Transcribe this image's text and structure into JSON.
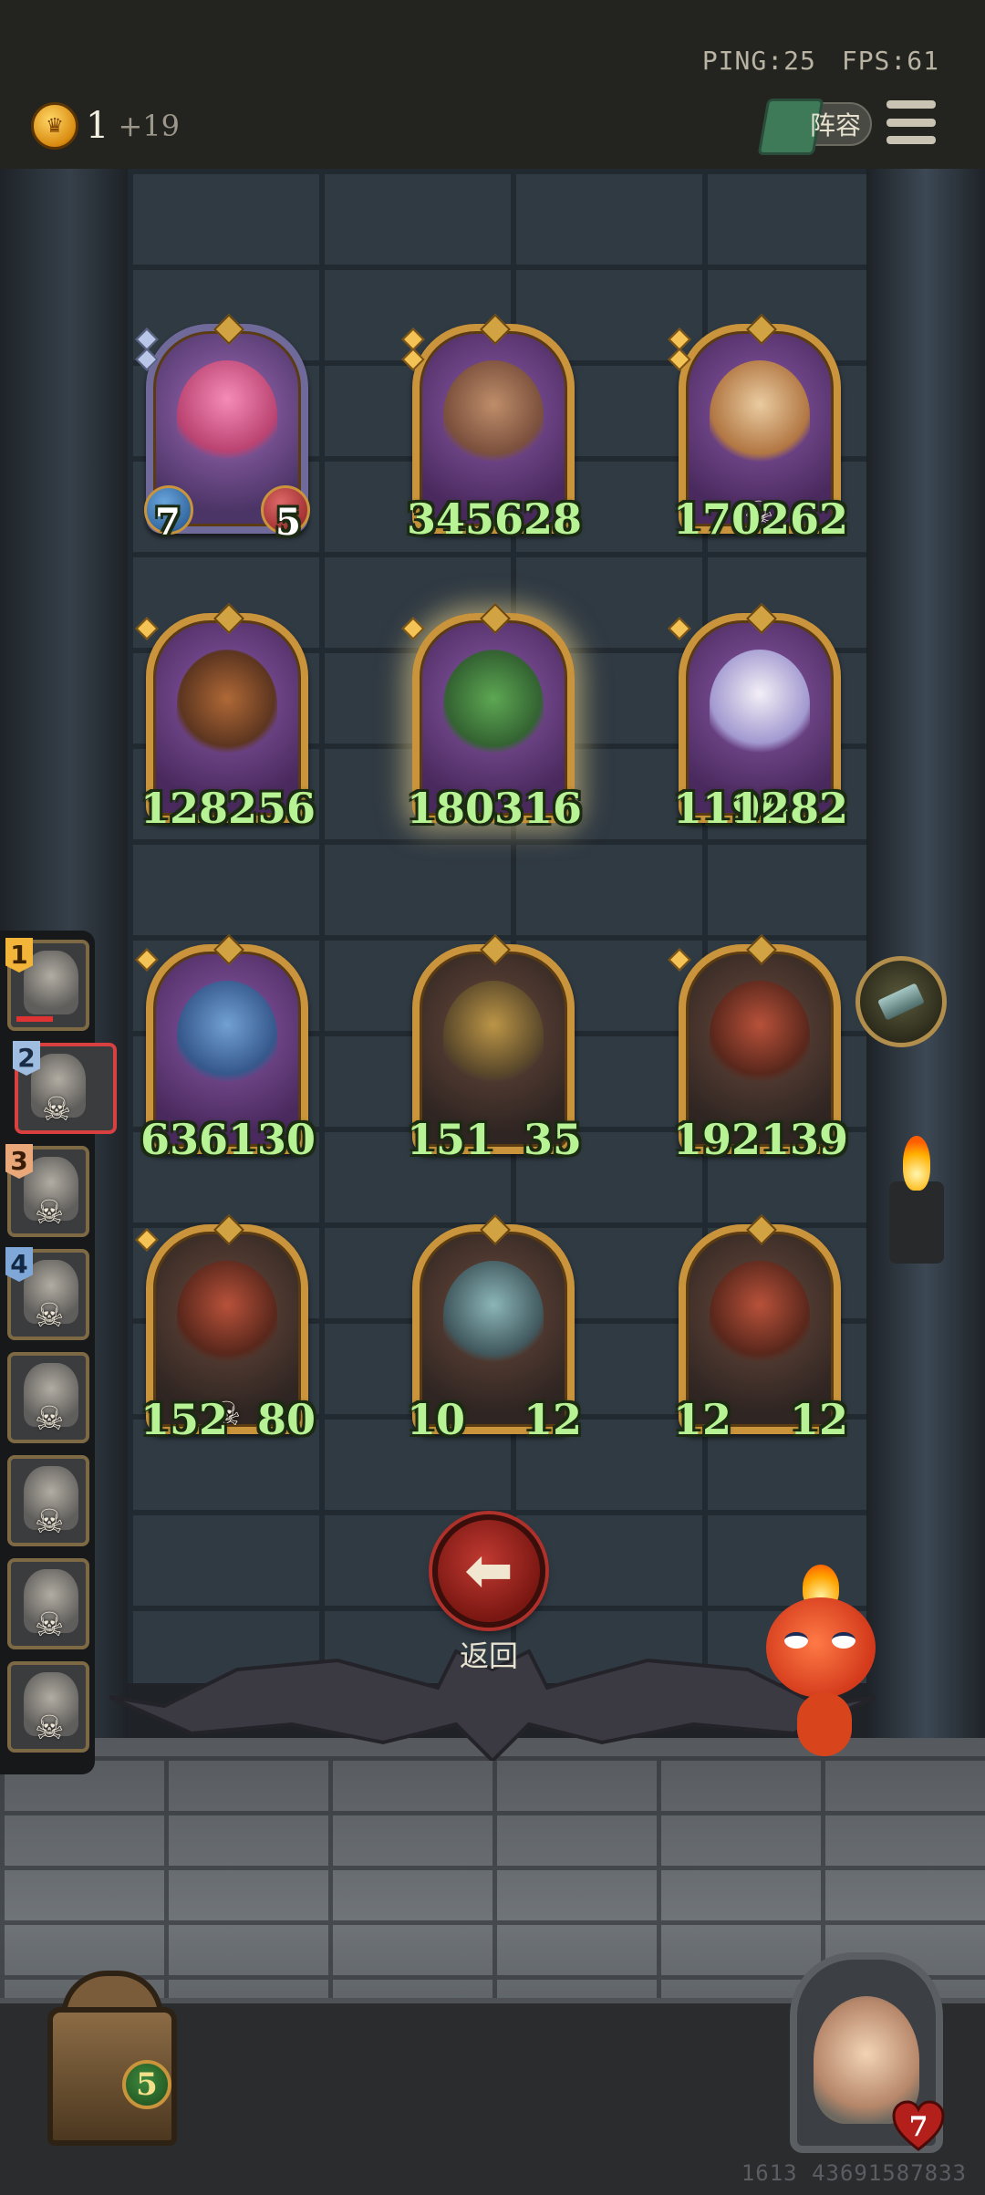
{
  "status": {
    "ping": "PING:25",
    "fps": "FPS:61"
  },
  "currency": {
    "gold": "1",
    "income": "+19"
  },
  "toolbar": {
    "lineup_label": "阵容",
    "menu_icon": "hamburger-menu-icon"
  },
  "board": {
    "cards": [
      {
        "portrait": "pink-haired-sorceress",
        "tier": 2,
        "frame": "silver",
        "attack": "7",
        "health": "5",
        "skull": false,
        "small_stats": true
      },
      {
        "portrait": "tree-ent",
        "tier": 2,
        "frame": "gold",
        "attack": "345",
        "health": "628",
        "skull": false
      },
      {
        "portrait": "orange-haired-girl",
        "tier": 2,
        "frame": "gold",
        "attack": "170",
        "health": "262",
        "skull": true
      },
      {
        "portrait": "pumpkin-monster",
        "tier": 1,
        "frame": "gold",
        "attack": "128",
        "health": "256",
        "skull": false
      },
      {
        "portrait": "cactus",
        "tier": 1,
        "frame": "gold",
        "attack": "180",
        "health": "316",
        "skull": false,
        "glow": true
      },
      {
        "portrait": "ghost-bride",
        "tier": 1,
        "frame": "gold",
        "attack": "1196",
        "health": "1282",
        "skull": false
      },
      {
        "portrait": "blue-dino",
        "tier": 1,
        "frame": "gold",
        "attack": "636",
        "health": "130",
        "skull": false
      },
      {
        "portrait": "armored-knight",
        "tier": 0,
        "frame": "gold",
        "attack": "151",
        "health": "35",
        "skull": false
      },
      {
        "portrait": "red-dragon",
        "tier": 1,
        "frame": "gold",
        "attack": "192",
        "health": "139",
        "skull": false
      },
      {
        "portrait": "red-dragon",
        "tier": 1,
        "frame": "gold",
        "attack": "152",
        "health": "80",
        "skull": true
      },
      {
        "portrait": "horned-beast",
        "tier": 0,
        "frame": "gold",
        "attack": "10",
        "health": "12",
        "skull": false
      },
      {
        "portrait": "red-dragon",
        "tier": 0,
        "frame": "gold",
        "attack": "12",
        "health": "12",
        "skull": false
      }
    ]
  },
  "queue": {
    "players": [
      {
        "rank": "1",
        "portrait": "old-sage",
        "eliminated": false,
        "active": false
      },
      {
        "rank": "2",
        "portrait": "grey-elder",
        "eliminated": true,
        "active": true
      },
      {
        "rank": "3",
        "portrait": "witch",
        "eliminated": true,
        "active": false
      },
      {
        "rank": "4",
        "portrait": "knight",
        "eliminated": true,
        "active": false
      },
      {
        "rank": "",
        "portrait": "hooded-woman",
        "eliminated": true,
        "active": false
      },
      {
        "rank": "",
        "portrait": "blonde-woman",
        "eliminated": true,
        "active": false
      },
      {
        "rank": "",
        "portrait": "raccoon",
        "eliminated": true,
        "active": false
      },
      {
        "rank": "",
        "portrait": "wolf",
        "eliminated": true,
        "active": false
      }
    ]
  },
  "item_badge": {
    "icon": "ingot-item-icon"
  },
  "back": {
    "label": "返回",
    "icon": "arrow-left-icon"
  },
  "hud": {
    "tavern_level": "5",
    "player_health": "7"
  },
  "footer": {
    "id": "1613 43691587833"
  },
  "colors": {
    "stat_text": "#b7f394",
    "frame_gold": "#c9943b",
    "frame_silver": "#6f6a9a",
    "back_button": "#c03a32"
  }
}
